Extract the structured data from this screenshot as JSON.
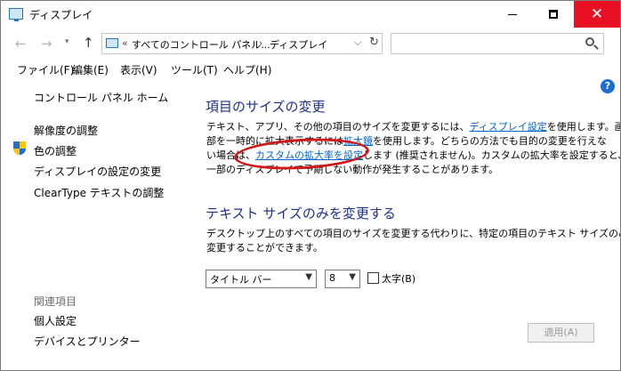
{
  "window": {
    "title": "ディスプレイ"
  },
  "address": {
    "overflow": "«",
    "crumbs": [
      "すべてのコントロール パネル...",
      "ディスプレイ"
    ],
    "search_placeholder": ""
  },
  "menu": [
    "ファイル(F)",
    "編集(E)",
    "表示(V)",
    "ツール(T)",
    "ヘルプ(H)"
  ],
  "help_glyph": "?",
  "sidebar": {
    "home": "コントロール パネル ホーム",
    "links": [
      "解像度の調整",
      "色の調整",
      "ディスプレイの設定の変更",
      "ClearType テキストの調整"
    ],
    "related_label": "関連項目",
    "related_links": [
      "個人設定",
      "デバイスとプリンター"
    ]
  },
  "main": {
    "section1": {
      "heading": "項目のサイズの変更",
      "line1_pre": "テキスト、アプリ、その他の項目のサイズを変更するには、",
      "line1_link": "ディスプレイ設定",
      "line1_post": "を使用します。画面の一",
      "line2_pre": "部を一時的に拡大表示するには",
      "line2_link": "拡大鏡",
      "line2_post": "を使用します。どちらの方法でも目的の変更を行えな",
      "line3_pre": "い場合は、",
      "line3_link": "カスタムの拡大率を設定",
      "line3_post": "します (推奨されません)。カスタムの拡大率を設定すると、",
      "line4": "一部のディスプレイで予期しない動作が発生することがあります。"
    },
    "section2": {
      "heading": "テキスト サイズのみを変更する",
      "line1": "デスクトップ上のすべての項目のサイズを変更する代わりに、特定の項目のテキスト サイズのみを",
      "line2": "変更することができます。",
      "item_select": "タイトル バー",
      "size_select": "8",
      "bold_label": "太字(B)",
      "bold_checked": false
    },
    "apply_label": "適用(A)"
  },
  "colors": {
    "heading": "#1e3287",
    "link": "#0066cc",
    "close": "#e81123",
    "annotation": "#d11818"
  }
}
